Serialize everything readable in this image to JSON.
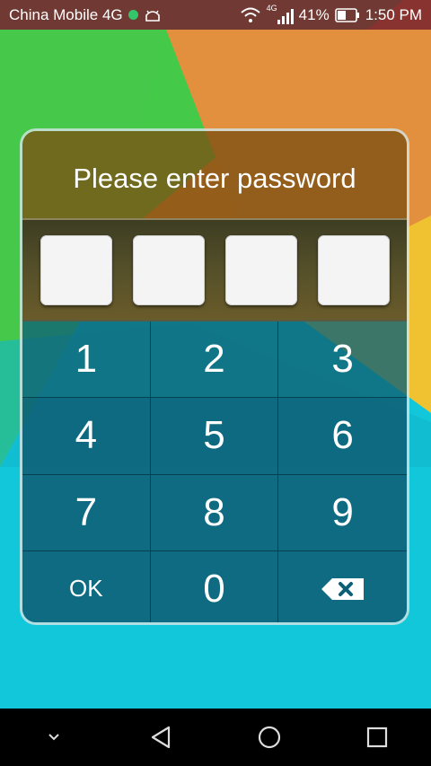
{
  "status_bar": {
    "carrier": "China Mobile 4G",
    "network_type": "4G",
    "battery_percent": "41%",
    "time": "1:50 PM",
    "icons": [
      "globe-dot-icon",
      "android-debug-icon",
      "wifi-icon",
      "signal-icon",
      "battery-icon"
    ]
  },
  "lock_screen": {
    "title": "Please enter password",
    "pin_slots": 4,
    "keys": [
      {
        "label": "1"
      },
      {
        "label": "2"
      },
      {
        "label": "3"
      },
      {
        "label": "4"
      },
      {
        "label": "5"
      },
      {
        "label": "6"
      },
      {
        "label": "7"
      },
      {
        "label": "8"
      },
      {
        "label": "9"
      },
      {
        "label": "OK"
      },
      {
        "label": "0"
      },
      {
        "icon": "backspace-icon"
      }
    ]
  },
  "nav_bar": {
    "icons": [
      "chevron-down-icon",
      "back-icon",
      "home-icon",
      "recents-icon"
    ]
  },
  "colors": {
    "status_bar": "#7a2030",
    "header": "#805212",
    "keypad": "#0d5f76",
    "pin_box": "#f4f4f4",
    "wallpaper_green": "#42c945",
    "wallpaper_orange": "#e9a23a",
    "wallpaper_cyan": "#13c7da"
  }
}
